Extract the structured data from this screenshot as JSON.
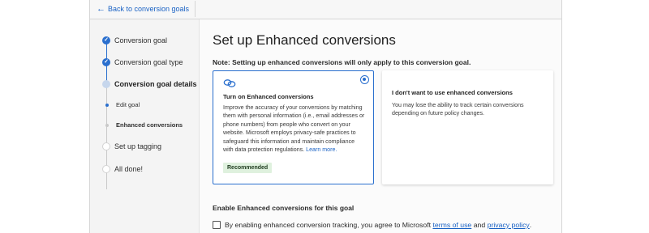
{
  "header": {
    "back_label": "Back to conversion goals"
  },
  "steps": [
    {
      "label": "Conversion goal",
      "state": "done"
    },
    {
      "label": "Conversion goal type",
      "state": "done"
    },
    {
      "label": "Conversion goal details",
      "state": "current"
    },
    {
      "label": "Set up tagging",
      "state": "todo"
    },
    {
      "label": "All done!",
      "state": "todo"
    }
  ],
  "substeps": [
    {
      "label": "Edit goal",
      "state": "done"
    },
    {
      "label": "Enhanced conversions",
      "state": "current"
    }
  ],
  "main": {
    "title": "Set up Enhanced conversions",
    "note": "Note: Setting up enhanced conversions will only apply to this conversion goal.",
    "option_on": {
      "title": "Turn on Enhanced conversions",
      "description": "Improve the accuracy of your conversions by matching them with personal information (i.e., email addresses or phone numbers) from people who convert on your website. Microsoft employs privacy-safe practices to safeguard this information and maintain compliance with data protection regulations.",
      "learn_more": "Learn more.",
      "badge": "Recommended",
      "selected": true
    },
    "option_off": {
      "title": "I don't want to use enhanced conversions",
      "description": "You may lose the ability to track certain conversions depending on future policy changes.",
      "selected": false
    },
    "enable_heading": "Enable Enhanced conversions for this goal",
    "consent": {
      "prefix": "By enabling enhanced conversion tracking, you agree to Microsoft",
      "terms_link": "terms of use",
      "and": "and",
      "privacy_link": "privacy policy",
      "suffix": ".",
      "checked": false
    }
  },
  "colors": {
    "accent": "#2a6fce",
    "link": "#1a62c4",
    "badge_bg": "#dff1de"
  },
  "icons": {
    "back": "arrow-left-icon",
    "option": "link-icon",
    "done": "checkmark-icon"
  }
}
